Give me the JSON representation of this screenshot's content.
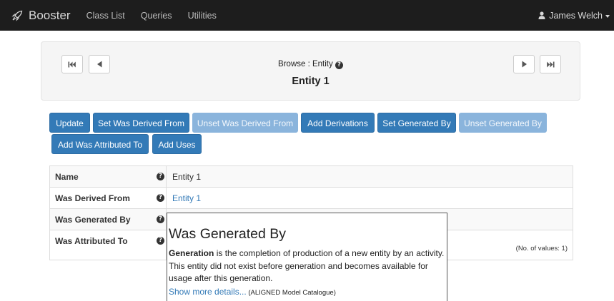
{
  "navbar": {
    "brand": "Booster",
    "links": [
      "Class List",
      "Queries",
      "Utilities"
    ],
    "user": "James Welch"
  },
  "browse": {
    "label": "Browse : Entity",
    "title": "Entity 1"
  },
  "actions": [
    "Update",
    "Set Was Derived From",
    "Unset Was Derived From",
    "Add Derivations",
    "Set Generated By",
    "Unset Generated By",
    "Add Was Attributed To",
    "Add Uses"
  ],
  "table": {
    "rows": [
      {
        "name": "Name",
        "value": "Entity 1"
      },
      {
        "name": "Was Derived From",
        "value": "Entity 1"
      },
      {
        "name": "Was Generated By",
        "value": ""
      },
      {
        "name": "Was Attributed To",
        "value": ""
      }
    ],
    "count_label": "(No. of values: 1)"
  },
  "popover": {
    "title": "Was Generated By",
    "term": "Generation",
    "body": " is the completion of production of a new entity by an activity. This entity did not exist before generation and becomes available for usage after this generation.",
    "more_link": "Show more details...",
    "source": " (ALIGNED Model Catalogue)"
  },
  "colors": {
    "navbar_bg": "#1d1d1d",
    "primary": "#337ab7",
    "primary_disabled": "#8ab4dc",
    "panel_bg": "#f5f5f5"
  },
  "icons": [
    "rocket-icon",
    "user-icon",
    "caret-down-icon",
    "first-page-icon",
    "prev-page-icon",
    "next-page-icon",
    "last-page-icon",
    "question-circle-icon"
  ]
}
